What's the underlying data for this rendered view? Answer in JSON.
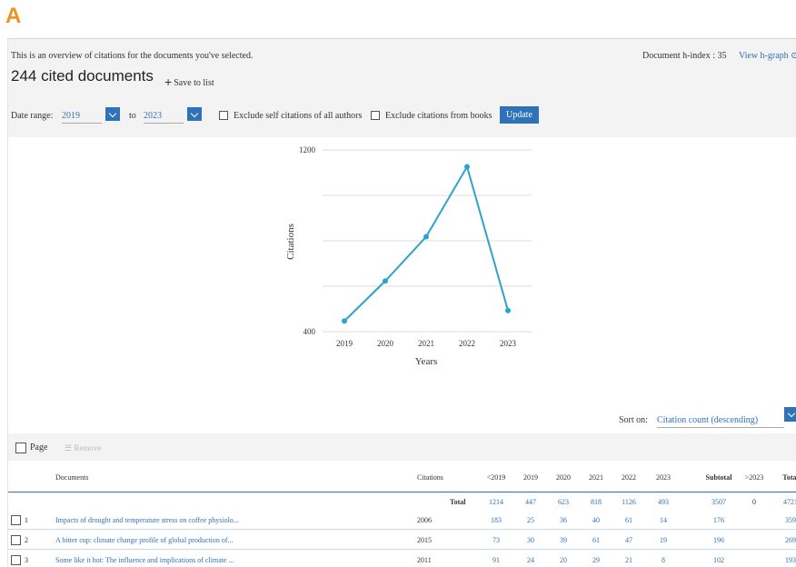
{
  "panel_letter": "A",
  "header": {
    "overview_text": "This is an overview of citations for the documents you've selected.",
    "hindex_text": "Document h-index : 35",
    "hgraph_link": "View h-graph ⊙",
    "cited_count": "244 cited documents",
    "save_label": "Save to list"
  },
  "filters": {
    "date_range_label": "Date range:",
    "from_year": "2019",
    "to_label": "to",
    "to_year": "2023",
    "exclude_self_label": "Exclude self citations of all authors",
    "exclude_books_label": "Exclude citations from books",
    "update_label": "Update"
  },
  "chart_data": {
    "type": "line",
    "x": [
      "2019",
      "2020",
      "2021",
      "2022",
      "2023"
    ],
    "series": [
      {
        "values": [
          447,
          623,
          818,
          1126,
          493
        ]
      }
    ],
    "xlabel": "Years",
    "ylabel": "Citations",
    "yticks": [
      "400",
      "1200"
    ],
    "ylim": [
      400,
      1200
    ],
    "grid": true,
    "color": "#2ba3cc"
  },
  "sort": {
    "label": "Sort on:",
    "value": "Citation count (descending)"
  },
  "page_bar": {
    "page_label": "Page",
    "remove_label": "Remove"
  },
  "table": {
    "headers": [
      "Documents",
      "Citations",
      "<2019",
      "2019",
      "2020",
      "2021",
      "2022",
      "2023",
      "Subtotal",
      ">2023",
      "Total"
    ],
    "total_row": {
      "label": "Total",
      "values": [
        "1214",
        "447",
        "623",
        "818",
        "1126",
        "493",
        "3507",
        "0",
        "4721"
      ]
    },
    "rows": [
      {
        "num": "1",
        "title": "Impacts of drought and temperature stress on coffee physiolo...",
        "year": "2006",
        "values": [
          "183",
          "25",
          "36",
          "40",
          "61",
          "14",
          "176",
          "",
          "359"
        ]
      },
      {
        "num": "2",
        "title": "A bitter cup: climate change profile of global production of...",
        "year": "2015",
        "values": [
          "73",
          "30",
          "39",
          "61",
          "47",
          "19",
          "196",
          "",
          "269"
        ]
      },
      {
        "num": "3",
        "title": "Some like it hot: The influence and implications of climate ...",
        "year": "2011",
        "values": [
          "91",
          "24",
          "20",
          "29",
          "21",
          "8",
          "102",
          "",
          "193"
        ]
      }
    ]
  }
}
